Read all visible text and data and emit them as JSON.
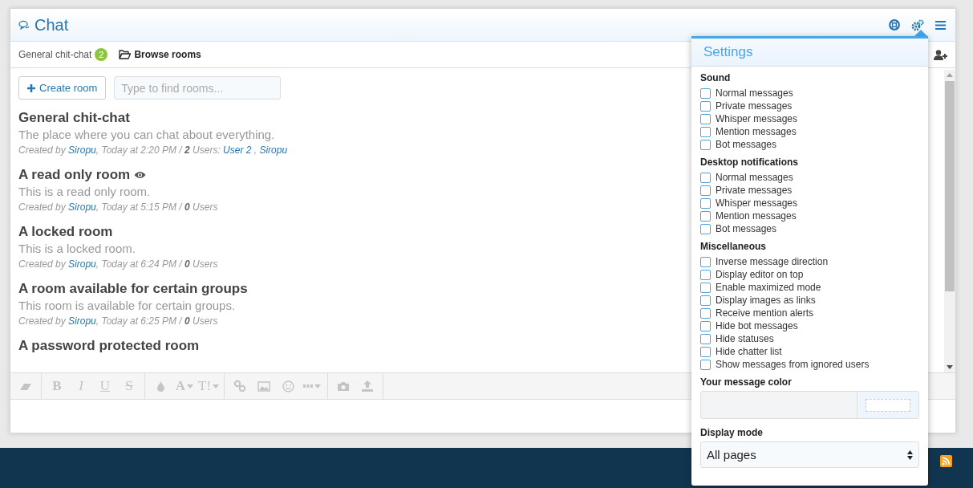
{
  "window": {
    "title": "Chat"
  },
  "tabs": [
    {
      "kind": "room",
      "label": "General chit-chat",
      "badge": "2",
      "selected": false
    },
    {
      "kind": "browse",
      "label": "Browse rooms",
      "selected": true
    }
  ],
  "create_button": {
    "label": "Create room"
  },
  "search": {
    "placeholder": "Type to find rooms..."
  },
  "rooms": [
    {
      "kind": "standard",
      "name": "General chit-chat",
      "description": "The place where you can chat about everything.",
      "meta": [
        {
          "kind": "text",
          "text": "Created by "
        },
        {
          "kind": "link",
          "text": "Siropu"
        },
        {
          "kind": "text",
          "text": ", Today at 2:20 PM / "
        },
        {
          "kind": "bold",
          "text": "2"
        },
        {
          "kind": "text",
          "text": " Users: "
        },
        {
          "kind": "link",
          "text": "User 2"
        },
        {
          "kind": "text",
          "text": " , "
        },
        {
          "kind": "link",
          "text": "Siropu"
        }
      ]
    },
    {
      "kind": "read_only",
      "name": "A read only room",
      "description": "This is a read only room.",
      "meta": [
        {
          "kind": "text",
          "text": "Created by "
        },
        {
          "kind": "link",
          "text": "Siropu"
        },
        {
          "kind": "text",
          "text": ", Today at 5:15 PM / "
        },
        {
          "kind": "bold",
          "text": "0"
        },
        {
          "kind": "text",
          "text": " Users"
        }
      ]
    },
    {
      "kind": "standard",
      "name": "A locked room",
      "description": "This is a locked room.",
      "meta": [
        {
          "kind": "text",
          "text": "Created by "
        },
        {
          "kind": "link",
          "text": "Siropu"
        },
        {
          "kind": "text",
          "text": ", Today at 6:24 PM / "
        },
        {
          "kind": "bold",
          "text": "0"
        },
        {
          "kind": "text",
          "text": " Users"
        }
      ]
    },
    {
      "kind": "standard",
      "name": "A room available for certain groups",
      "description": "This room is available for certain groups.",
      "meta": [
        {
          "kind": "text",
          "text": "Created by "
        },
        {
          "kind": "link",
          "text": "Siropu"
        },
        {
          "kind": "text",
          "text": ", Today at 6:25 PM / "
        },
        {
          "kind": "bold",
          "text": "0"
        },
        {
          "kind": "text",
          "text": " Users"
        }
      ]
    },
    {
      "kind": "standard",
      "name": "A password protected room"
    }
  ],
  "toolbar": [
    [
      {
        "kind": "eraser"
      }
    ],
    [
      {
        "kind": "bold",
        "glyph": "B"
      },
      {
        "kind": "italic",
        "glyph": "I"
      },
      {
        "kind": "underline",
        "glyph": "U"
      },
      {
        "kind": "strike",
        "glyph": "S"
      }
    ],
    [
      {
        "kind": "drop"
      },
      {
        "kind": "font",
        "glyph": "A",
        "dropdown": true
      },
      {
        "kind": "size",
        "glyph": "T!",
        "dropdown": true
      }
    ],
    [
      {
        "kind": "link"
      },
      {
        "kind": "image"
      },
      {
        "kind": "smiley"
      },
      {
        "kind": "more",
        "dropdown": true
      }
    ],
    [
      {
        "kind": "camera"
      },
      {
        "kind": "upload"
      }
    ]
  ],
  "settings": {
    "title": "Settings",
    "sections": [
      {
        "heading": "Sound",
        "options": [
          {
            "label": "Normal messages",
            "checked": false
          },
          {
            "label": "Private messages",
            "checked": false
          },
          {
            "label": "Whisper messages",
            "checked": false
          },
          {
            "label": "Mention messages",
            "checked": false
          },
          {
            "label": "Bot messages",
            "checked": false
          }
        ]
      },
      {
        "heading": "Desktop notifications",
        "options": [
          {
            "label": "Normal messages",
            "checked": false
          },
          {
            "label": "Private messages",
            "checked": false
          },
          {
            "label": "Whisper messages",
            "checked": false
          },
          {
            "label": "Mention messages",
            "checked": false
          },
          {
            "label": "Bot messages",
            "checked": false
          }
        ]
      },
      {
        "heading": "Miscellaneous",
        "options": [
          {
            "label": "Inverse message direction",
            "checked": false
          },
          {
            "label": "Display editor on top",
            "checked": false
          },
          {
            "label": "Enable maximized mode",
            "checked": false
          },
          {
            "label": "Display images as links",
            "checked": false
          },
          {
            "label": "Receive mention alerts",
            "checked": false
          },
          {
            "label": "Hide bot messages",
            "checked": false
          },
          {
            "label": "Hide statuses",
            "checked": false
          },
          {
            "label": "Hide chatter list",
            "checked": false
          },
          {
            "label": "Show messages from ignored users",
            "checked": false
          }
        ]
      }
    ],
    "color_label": "Your message color",
    "display_mode_label": "Display mode",
    "display_mode": "All pages"
  }
}
